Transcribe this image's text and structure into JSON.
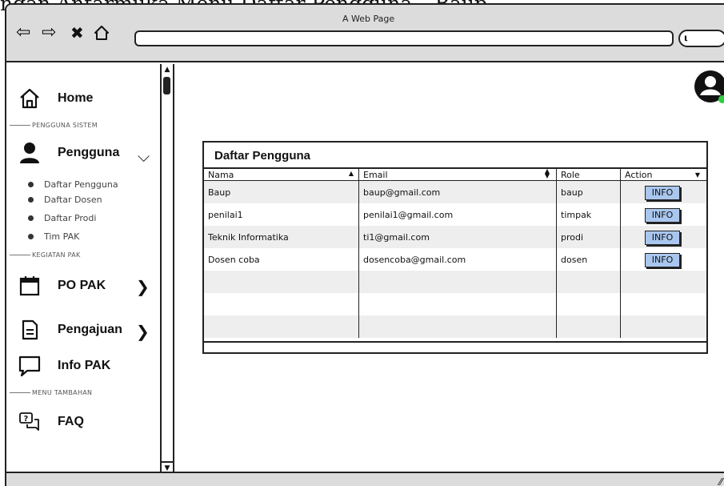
{
  "caption": "ngan Antarmuka Menu Daftar Pengguna – Baup",
  "window": {
    "title": "A Web Page"
  },
  "browser": {
    "nav_icons": [
      "back-icon",
      "forward-icon",
      "stop-icon",
      "home-icon"
    ],
    "search_icon": "search-icon"
  },
  "sidebar": {
    "home": {
      "label": "Home",
      "icon": "home-icon"
    },
    "section_pengguna_sistem": "PENGGUNA SISTEM",
    "pengguna": {
      "label": "Pengguna",
      "icon": "user-icon",
      "chevron": "chevron-down-icon"
    },
    "sub_items": [
      {
        "label": "Daftar Pengguna"
      },
      {
        "label": "Daftar Dosen"
      },
      {
        "label": "Daftar Prodi"
      },
      {
        "label": "Tim PAK"
      }
    ],
    "section_kegiatan_pak": "KEGIATAN PAK",
    "po_pak": {
      "label": "PO PAK",
      "icon": "calendar-icon",
      "chevron": "chevron-right-icon"
    },
    "pengajuan": {
      "label": "Pengajuan",
      "icon": "document-icon",
      "chevron": "chevron-right-icon"
    },
    "info_pak": {
      "label": "Info PAK",
      "icon": "chat-icon"
    },
    "section_menu_tambahan": "MENU TAMBAHAN",
    "faq": {
      "label": "FAQ",
      "icon": "faq-icon"
    }
  },
  "header": {
    "avatar_icon": "user-avatar-icon",
    "status_color": "#2ecc40"
  },
  "panel": {
    "title": "Daftar Pengguna",
    "columns": [
      "Nama",
      "Email",
      "Role",
      "Action"
    ],
    "rows": [
      {
        "nama": "Baup",
        "email": "baup@gmail.com",
        "role": "baup",
        "action": "INFO"
      },
      {
        "nama": "penilai1",
        "email": "penilai1@gmail.com",
        "role": "timpak",
        "action": "INFO"
      },
      {
        "nama": "Teknik Informatika",
        "email": "ti1@gmail.com",
        "role": "prodi",
        "action": "INFO"
      },
      {
        "nama": "Dosen coba",
        "email": "dosencoba@gmail.com",
        "role": "dosen",
        "action": "INFO"
      }
    ]
  },
  "colors": {
    "button_fill": "#a9c6ee",
    "chrome_gray": "#dcdcdc",
    "row_stripe": "#eeeeee"
  }
}
